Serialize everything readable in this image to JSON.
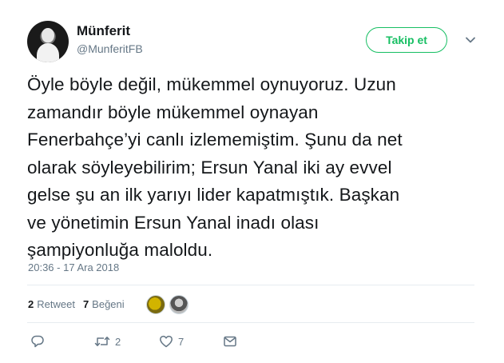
{
  "author": {
    "display_name": "Münferit",
    "username": "@MunferitFB"
  },
  "follow_label": "Takip et",
  "tweet": {
    "lines": [
      "Öyle böyle değil, mükemmel oynuyoruz. Uzun",
      "zamandır böyle mükemmel oynayan",
      "Fenerbahçe’yi canlı izlememiştim. Şunu da net",
      "olarak söyleyebilirim; Ersun Yanal iki ay evvel",
      "gelse şu an ilk yarıyı lider kapatmıştık. Başkan",
      "ve yönetimin Ersun Yanal inadı olası",
      "şampiyonluğa maloldu."
    ],
    "timestamp": "20:36 - 17 Ara 2018"
  },
  "stats": {
    "retweet_count": "2",
    "retweet_label": "Retweet",
    "like_count": "7",
    "like_label": "Beğeni"
  },
  "actions": {
    "reply_count": "",
    "retweet_count": "2",
    "like_count": "7"
  },
  "icons": {
    "reply": "reply-icon",
    "retweet": "retweet-icon",
    "like": "heart-icon",
    "dm": "envelope-icon",
    "menu": "chevron-down-icon"
  },
  "colors": {
    "follow_accent": "#17bf63",
    "secondary_text": "#657786",
    "primary_text": "#14171a"
  }
}
